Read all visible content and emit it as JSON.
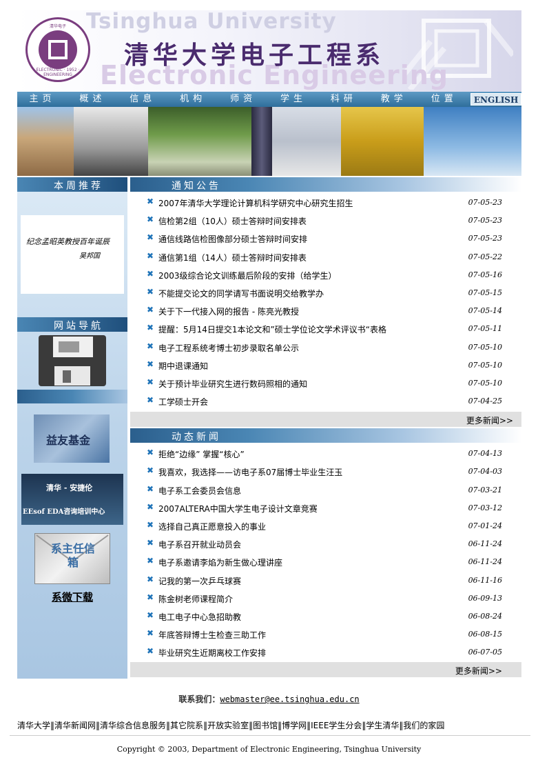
{
  "header": {
    "title": "清华大学电子工程系",
    "bg_text_top": "Tsinghua University",
    "bg_text_bottom": "Electronic Engineering",
    "logo_ring_text": "ELECTRONIC · 1952 · ENGINEERING",
    "logo_top_text": "清华电子"
  },
  "nav": {
    "items": [
      "主页",
      "概述",
      "信息",
      "机构",
      "师资",
      "学生",
      "科研",
      "教学",
      "位置"
    ],
    "english": "ENGLISH"
  },
  "left": {
    "weekly_title": "本周推荐",
    "calligraphy_main": "纪念孟昭英教授百年诞辰",
    "calligraphy_sign": "吴邦国",
    "nav_title": "网站导航",
    "fund_banner": "益友基金",
    "agilent_line1": "清华 - 安捷伦",
    "agilent_line2": "EEsof EDA咨询培训中心",
    "mailbox_banner": "系主任信箱",
    "download_link": "系微下载"
  },
  "notices": {
    "title": "通知公告",
    "items": [
      {
        "t": "2007年清华大学理论计算机科学研究中心研究生招生",
        "d": "07-05-23"
      },
      {
        "t": "信检第2组（10人）硕士答辩时间安排表",
        "d": "07-05-23"
      },
      {
        "t": "通信线路信检图像部分硕士答辩时间安排",
        "d": "07-05-23"
      },
      {
        "t": "通信第1组（14人）硕士答辩时间安排表",
        "d": "07-05-22"
      },
      {
        "t": "2003级综合论文训练最后阶段的安排（给学生）",
        "d": "07-05-16"
      },
      {
        "t": "不能提交论文的同学请写书面说明交给教学办",
        "d": "07-05-15"
      },
      {
        "t": "关于下一代接入网的报告 - 陈亮光教授",
        "d": "07-05-14"
      },
      {
        "t": "提醒：5月14日提交1本论文和”硕士学位论文学术评议书“表格",
        "d": "07-05-11"
      },
      {
        "t": "电子工程系统考博士初步录取名单公示",
        "d": "07-05-10"
      },
      {
        "t": "期中退课通知",
        "d": "07-05-10"
      },
      {
        "t": "关于预计毕业研究生进行数码照相的通知",
        "d": "07-05-10"
      },
      {
        "t": "工学硕士开会",
        "d": "07-04-25"
      }
    ],
    "more": "更多新闻>>"
  },
  "news": {
    "title": "动态新闻",
    "items": [
      {
        "t": "拒绝“边缘” 掌握“核心”",
        "d": "07-04-13"
      },
      {
        "t": "我喜欢，我选择——访电子系07届博士毕业生汪玉",
        "d": "07-04-03"
      },
      {
        "t": "电子系工会委员会信息",
        "d": "07-03-21"
      },
      {
        "t": "2007ALTERA中国大学生电子设计文章竞赛",
        "d": "07-03-12"
      },
      {
        "t": "选择自己真正愿意投入的事业",
        "d": "07-01-24"
      },
      {
        "t": "电子系召开就业动员会",
        "d": "06-11-24"
      },
      {
        "t": "电子系邀请李焰为新生做心理讲座",
        "d": "06-11-24"
      },
      {
        "t": "记我的第一次乒乓球赛",
        "d": "06-11-16"
      },
      {
        "t": "陈金树老师课程简介",
        "d": "06-09-13"
      },
      {
        "t": "电工电子中心急招助教",
        "d": "06-08-24"
      },
      {
        "t": "年底答辩博士生检查三助工作",
        "d": "06-08-15"
      },
      {
        "t": "毕业研究生近期离校工作安排",
        "d": "06-07-05"
      }
    ],
    "more": "更多新闻>>"
  },
  "footer": {
    "contact_label": "联系我们：",
    "email": "webmaster@ee.tsinghua.edu.cn",
    "links": [
      "清华大学",
      "清华新闻网",
      "清华综合信息服务",
      "其它院系",
      "开放实验室",
      "图书馆",
      "博学网",
      "IEEE学生分会",
      "学生清华",
      "我们的家园"
    ],
    "copyright": "Copyright © 2003, Department of Electronic Engineering, Tsinghua University"
  },
  "colors": {
    "nav": "#3f7fae",
    "accent": "#1e73b8",
    "brand_purple": "#7a3d7f"
  }
}
